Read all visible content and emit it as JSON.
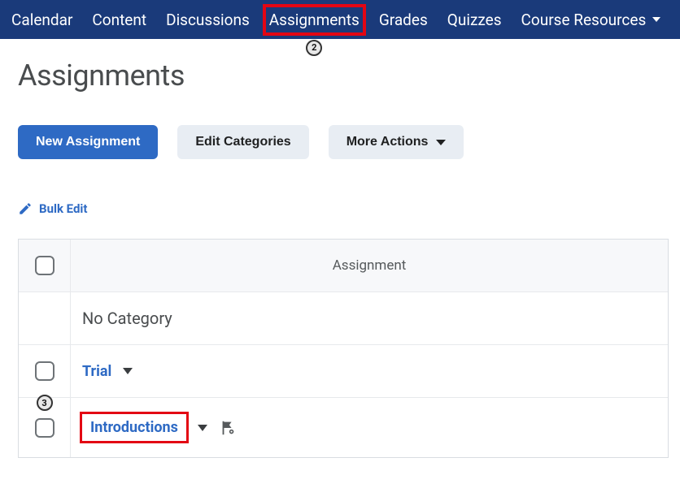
{
  "nav": {
    "items": [
      {
        "label": "Calendar"
      },
      {
        "label": "Content"
      },
      {
        "label": "Discussions"
      },
      {
        "label": "Assignments",
        "highlighted": true
      },
      {
        "label": "Grades"
      },
      {
        "label": "Quizzes"
      },
      {
        "label": "Course Resources",
        "dropdown": true
      }
    ]
  },
  "callouts": {
    "assignments_tab": "2",
    "introductions_row": "3"
  },
  "page": {
    "title": "Assignments"
  },
  "actions": {
    "new_assignment": "New Assignment",
    "edit_categories": "Edit Categories",
    "more_actions": "More Actions"
  },
  "bulk_edit_label": "Bulk Edit",
  "table": {
    "header": "Assignment",
    "no_category": "No Category",
    "rows": [
      {
        "name": "Trial"
      },
      {
        "name": "Introductions",
        "highlighted": true
      }
    ]
  }
}
